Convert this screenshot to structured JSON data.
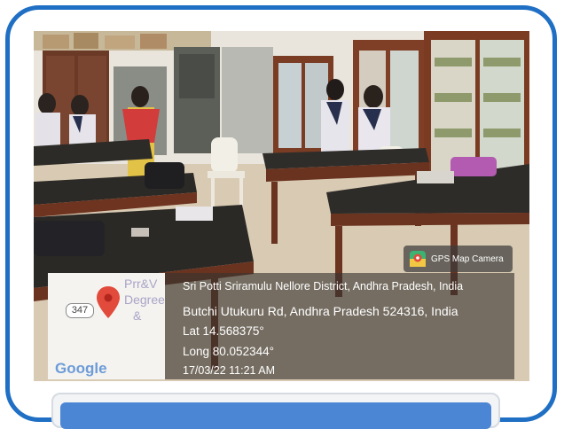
{
  "photo": {
    "scene_subject": "classroom-lab-with-students"
  },
  "gps_badge": {
    "label": "GPS Map Camera",
    "icon": "gps-map-camera-icon"
  },
  "map": {
    "place_label_line1": "Prr&V",
    "place_label_line2": "Degree",
    "place_label_line3": "&",
    "road_shield": "347",
    "brand": "Google",
    "pin_icon": "location-pin-icon",
    "pin_color": "#e24a3b"
  },
  "location": {
    "line1": "Sri Potti Sriramulu Nellore District, Andhra Pradesh, India",
    "line2": "Butchi Utukuru Rd, Andhra Pradesh 524316, India",
    "latitude": "Lat 14.568375°",
    "longitude": "Long 80.052344°",
    "timestamp": "17/03/22 11:21 AM"
  },
  "colors": {
    "frame": "#1f6fc4",
    "bar": "#4b86d4"
  }
}
